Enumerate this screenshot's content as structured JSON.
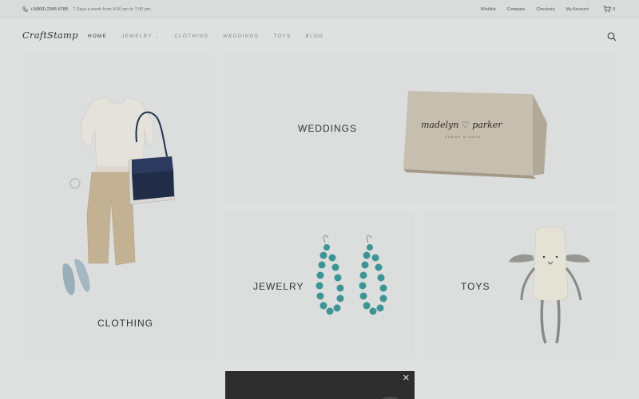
{
  "topbar": {
    "phone": "+3(800) 2345-6789",
    "hours": "7 Days a week from 9:00 am to 7:00 pm",
    "links": [
      "Wishlist",
      "Compare",
      "Checkout",
      "My Account"
    ],
    "cart_count": "0"
  },
  "header": {
    "logo": "CraftStamp",
    "nav": [
      {
        "label": "HOME",
        "active": true
      },
      {
        "label": "JEWELRY",
        "has_dropdown": true
      },
      {
        "label": "CLOTHING"
      },
      {
        "label": "WEDDINGS"
      },
      {
        "label": "TOYS"
      },
      {
        "label": "BLOG"
      }
    ]
  },
  "tiles": {
    "clothing": "CLOTHING",
    "weddings": "WEDDINGS",
    "jewelry": "JEWELRY",
    "toys": "TOYS"
  },
  "card": {
    "name_line": "madelyn ♡ parker",
    "sub_line": "CARDS STUDIO"
  },
  "popup": {
    "close": "✕"
  },
  "colors": {
    "background": "#e9eaea",
    "tile": "#e6e7e7",
    "popup": "#2c2c2d"
  }
}
